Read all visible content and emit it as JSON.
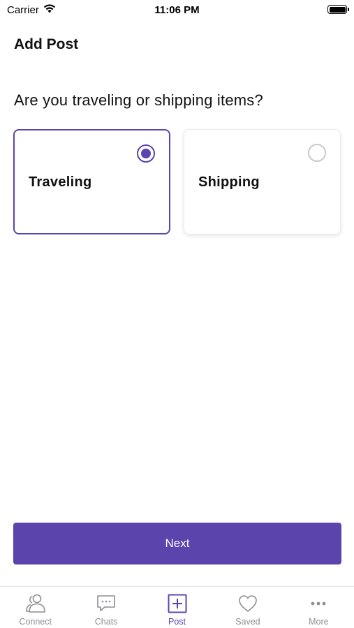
{
  "status_bar": {
    "carrier": "Carrier",
    "time": "11:06 PM"
  },
  "header": {
    "title": "Add Post"
  },
  "question": "Are you traveling or shipping items?",
  "options": [
    {
      "label": "Traveling",
      "selected": true
    },
    {
      "label": "Shipping",
      "selected": false
    }
  ],
  "next_button": {
    "label": "Next"
  },
  "tab_bar": {
    "tabs": [
      {
        "label": "Connect",
        "icon": "users-icon",
        "active": false
      },
      {
        "label": "Chats",
        "icon": "chat-bubble-icon",
        "active": false
      },
      {
        "label": "Post",
        "icon": "plus-square-icon",
        "active": true
      },
      {
        "label": "Saved",
        "icon": "heart-icon",
        "active": false
      },
      {
        "label": "More",
        "icon": "more-dots-icon",
        "active": false
      }
    ]
  },
  "colors": {
    "accent": "#5c44ad",
    "inactive": "#8e8e93"
  }
}
